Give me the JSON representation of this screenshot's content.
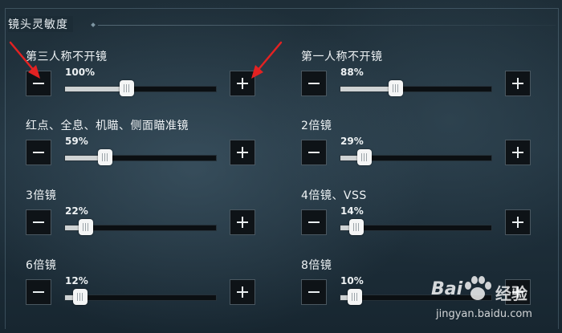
{
  "section_title": "镜头灵敏度",
  "settings": [
    {
      "label": "第三人称不开镜",
      "value_text": "100%",
      "level": 1.0
    },
    {
      "label": "第一人称不开镜",
      "value_text": "88%",
      "level": 0.88
    },
    {
      "label": "红点、全息、机瞄、侧面瞄准镜",
      "value_text": "59%",
      "level": 0.59
    },
    {
      "label": "2倍镜",
      "value_text": "29%",
      "level": 0.29
    },
    {
      "label": "3倍镜",
      "value_text": "22%",
      "level": 0.22
    },
    {
      "label": "4倍镜、VSS",
      "value_text": "14%",
      "level": 0.14
    },
    {
      "label": "6倍镜",
      "value_text": "12%",
      "level": 0.12
    },
    {
      "label": "8倍镜",
      "value_text": "10%",
      "level": 0.1
    }
  ],
  "slider_range_pct": [
    0,
    300
  ],
  "icons": {
    "decrease": "minus-icon",
    "increase": "plus-icon",
    "annotation": "red-arrow-icon"
  },
  "colors": {
    "annotation_arrow": "#e32222",
    "track_fill": "#cfd3d4",
    "thumb": "#f4f5f5"
  },
  "watermark": {
    "brand": "Bai",
    "brand_label": "经验",
    "url": "jingyan.baidu.com"
  }
}
